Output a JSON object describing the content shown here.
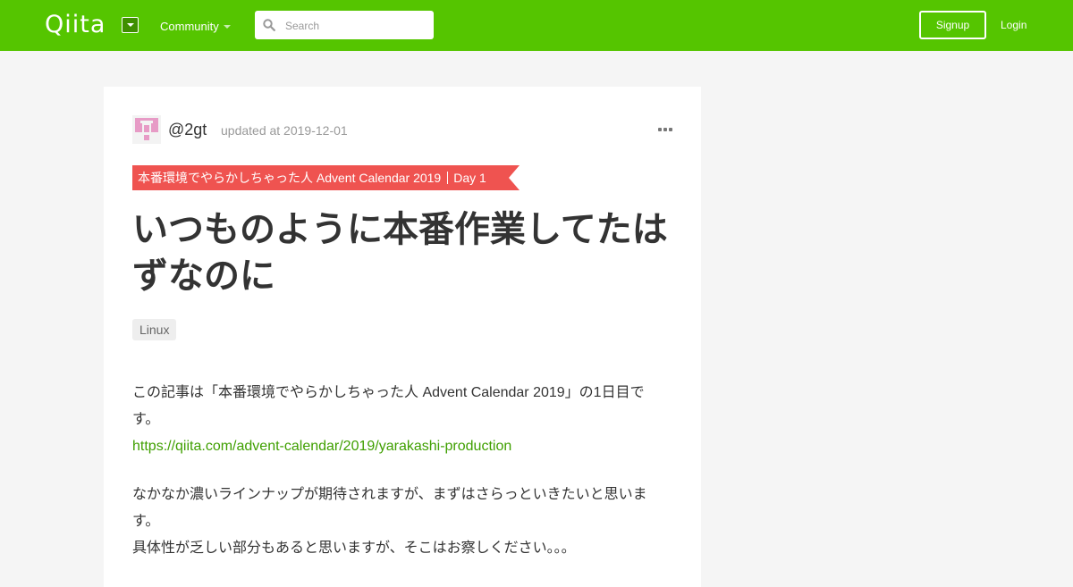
{
  "header": {
    "logo": "Qiita",
    "community_label": "Community",
    "search_placeholder": "Search",
    "signup_label": "Signup",
    "login_label": "Login",
    "brand_color": "#55c500"
  },
  "article": {
    "author": "@2gt",
    "updated": "updated at 2019-12-01",
    "calendar": {
      "name": "本番環境でやらかしちゃった人 Advent Calendar 2019",
      "day": "Day 1",
      "color": "#ef5350"
    },
    "title": "いつものように本番作業してたはずなのに",
    "tags": [
      "Linux"
    ],
    "paragraph1_line1": "この記事は「本番環境でやらかしちゃった人 Advent Calendar 2019」の1日目です。",
    "paragraph1_link": "https://qiita.com/advent-calendar/2019/yarakashi-production",
    "paragraph2_line1": "なかなか濃いラインナップが期待されますが、まずはさらっといきたいと思います。",
    "paragraph2_line2": "具体性が乏しい部分もあると思いますが、そこはお察しください。。。"
  }
}
